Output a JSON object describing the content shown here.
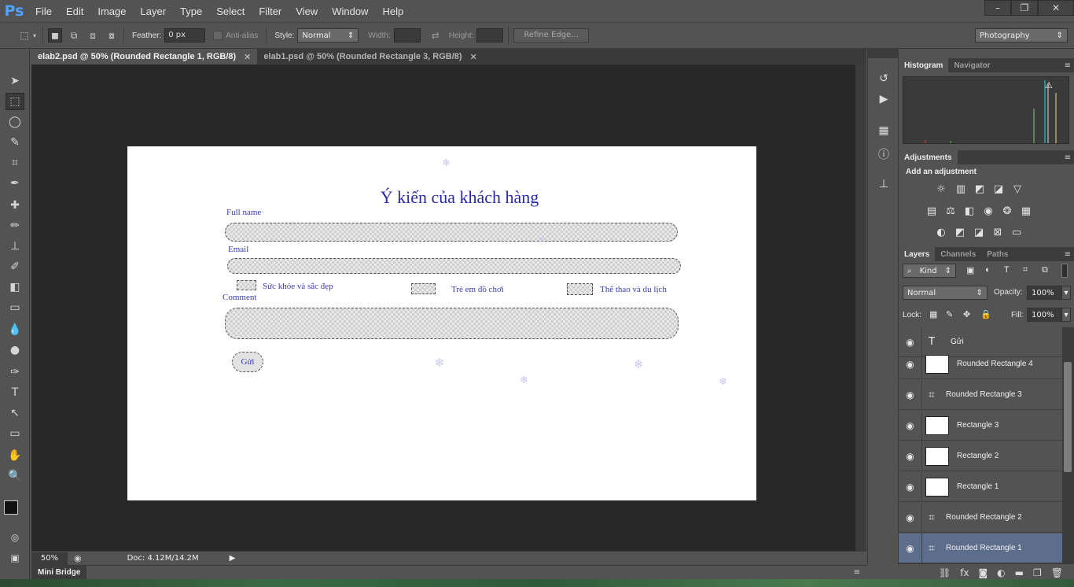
{
  "app": {
    "logo": "Ps"
  },
  "menu": [
    "File",
    "Edit",
    "Image",
    "Layer",
    "Type",
    "Select",
    "Filter",
    "View",
    "Window",
    "Help"
  ],
  "window_controls": {
    "minimize": "–",
    "restore": "❐",
    "close": "✕"
  },
  "options": {
    "feather_label": "Feather:",
    "feather_value": "0 px",
    "antialias_label": "Anti-alias",
    "style_label": "Style:",
    "style_value": "Normal",
    "width_label": "Width:",
    "height_label": "Height:",
    "refine_label": "Refine Edge...",
    "workspace": "Photography"
  },
  "tabs": [
    {
      "label": "elab2.psd @ 50% (Rounded Rectangle 1, RGB/8)",
      "active": true
    },
    {
      "label": "elab1.psd @ 50% (Rounded Rectangle 3, RGB/8)",
      "active": false
    }
  ],
  "document": {
    "title": "Ý kiến của khách hàng",
    "fullname_label": "Full name",
    "email_label": "Email",
    "checkbox1": "Sức khỏe và sắc đẹp",
    "checkbox2": "Trẻ em đồ chơi",
    "checkbox3": "Thể thao và du lịch",
    "comment_label": "Comment",
    "send_label": "Gửi"
  },
  "status": {
    "zoom": "50%",
    "doc": "Doc: 4.12M/14.2M"
  },
  "mini_bridge": "Mini Bridge",
  "panels": {
    "histogram_tabs": [
      "Histogram",
      "Navigator"
    ],
    "adjustments_tab": "Adjustments",
    "adjustments_title": "Add an adjustment",
    "layers_tabs": [
      "Layers",
      "Channels",
      "Paths"
    ],
    "kind_label": "Kind",
    "blend_mode": "Normal",
    "opacity_label": "Opacity:",
    "opacity_value": "100%",
    "lock_label": "Lock:",
    "fill_label": "Fill:",
    "fill_value": "100%"
  },
  "layers": [
    {
      "name": "Gửi",
      "kind": "type"
    },
    {
      "name": "Rounded Rectangle 4",
      "kind": "raster"
    },
    {
      "name": "Rounded Rectangle 3",
      "kind": "shape"
    },
    {
      "name": "Rectangle 3",
      "kind": "raster"
    },
    {
      "name": "Rectangle 2",
      "kind": "raster"
    },
    {
      "name": "Rectangle 1",
      "kind": "raster"
    },
    {
      "name": "Rounded Rectangle 2",
      "kind": "shape"
    },
    {
      "name": "Rounded Rectangle 1",
      "kind": "shape",
      "selected": true
    }
  ],
  "colors": {
    "accent_blue": "#4da3ff",
    "form_text": "#2a2aa8",
    "selected_layer": "#5c6e8c"
  }
}
